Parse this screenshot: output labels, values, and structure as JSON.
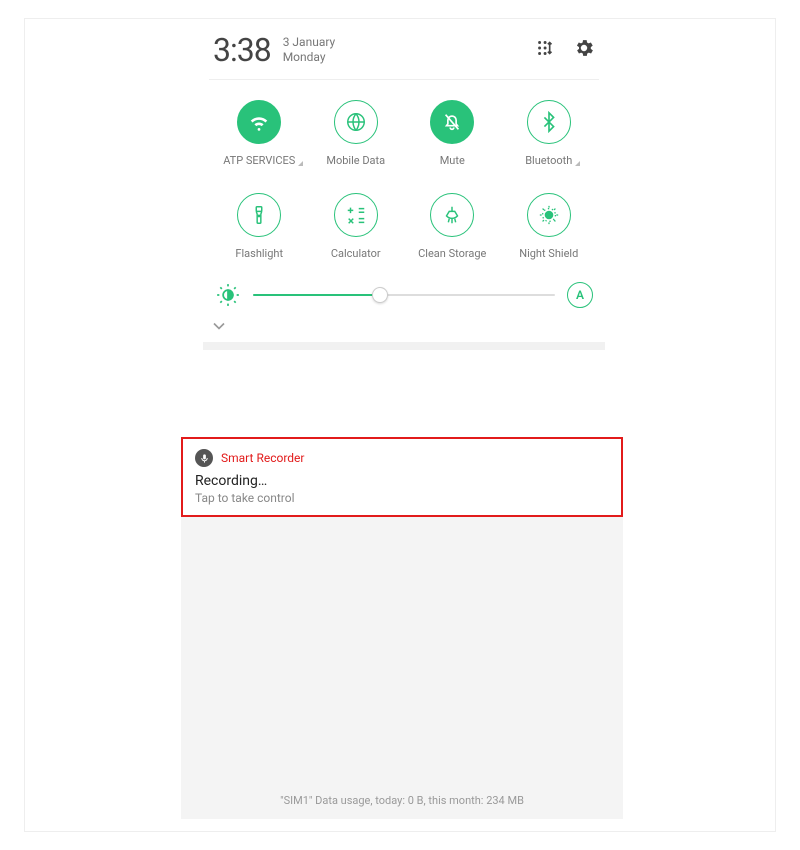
{
  "statusbar": {
    "time": "3:38",
    "date_top": "3 January",
    "date_bottom": "Monday"
  },
  "tiles": [
    {
      "id": "wifi",
      "label": "ATP SERVICES",
      "icon": "wifi",
      "active": true,
      "expandable": true
    },
    {
      "id": "data",
      "label": "Mobile Data",
      "icon": "globe",
      "active": false,
      "expandable": false
    },
    {
      "id": "mute",
      "label": "Mute",
      "icon": "bell-off",
      "active": true,
      "expandable": false
    },
    {
      "id": "bluetooth",
      "label": "Bluetooth",
      "icon": "bluetooth",
      "active": false,
      "expandable": true
    },
    {
      "id": "flashlight",
      "label": "Flashlight",
      "icon": "flashlight",
      "active": false,
      "expandable": false
    },
    {
      "id": "calculator",
      "label": "Calculator",
      "icon": "calculator",
      "active": false,
      "expandable": false
    },
    {
      "id": "clean",
      "label": "Clean Storage",
      "icon": "broom",
      "active": false,
      "expandable": false
    },
    {
      "id": "night",
      "label": "Night Shield",
      "icon": "night",
      "active": false,
      "expandable": false
    }
  ],
  "brightness": {
    "percent": 42,
    "auto_label": "A"
  },
  "notification": {
    "app_name": "Smart Recorder",
    "title": "Recording…",
    "subtitle": "Tap to take control"
  },
  "footer": {
    "data_usage": "\"SIM1\" Data usage, today: 0 B, this month: 234 MB"
  },
  "colors": {
    "accent": "#29c27a",
    "highlight_border": "#e21b1b"
  }
}
